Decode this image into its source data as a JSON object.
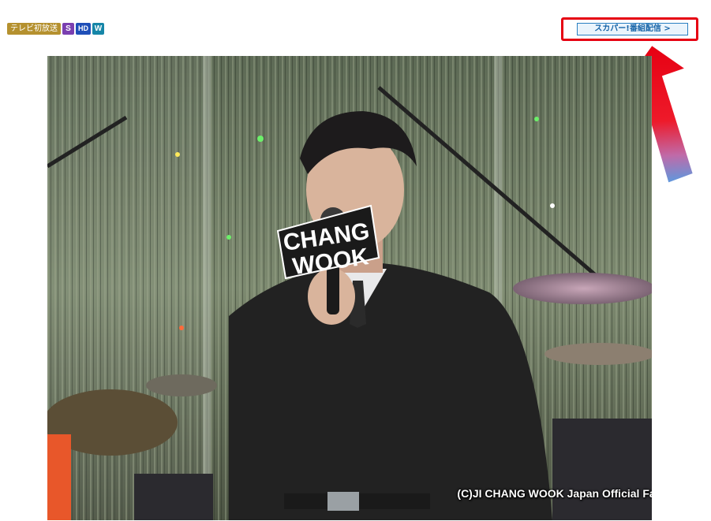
{
  "badges": {
    "tv_first": "テレビ初放送",
    "s": "S",
    "hd": "HD",
    "w": "W"
  },
  "skyperfect_button": {
    "label": "スカパー!番組配信 >"
  },
  "photo": {
    "sign_line1": "CHANG",
    "sign_line2": "WOOK",
    "credit": "(C)JI CHANG WOOK Japan Official Fanclub"
  },
  "colors": {
    "highlight_border": "#e60012",
    "arrow_red": "#e60012",
    "arrow_blue": "#4a8fd8",
    "button_border": "#2a7fc1"
  }
}
